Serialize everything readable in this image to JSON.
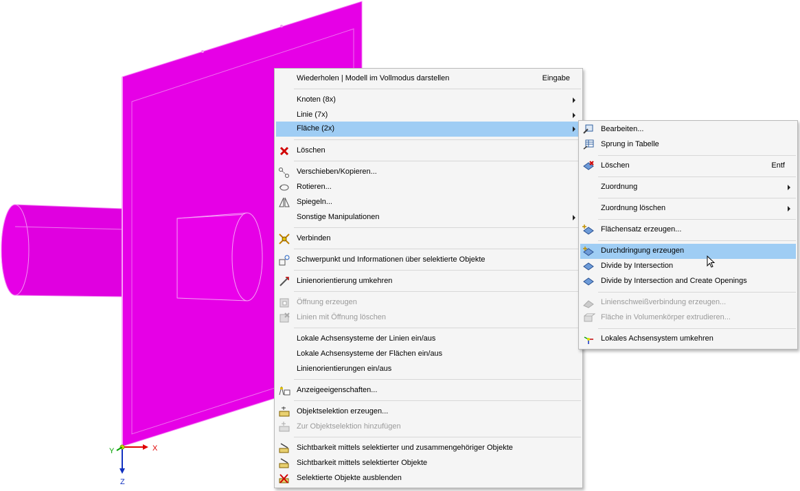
{
  "colors": {
    "model": "#e600e6",
    "menu_bg": "#f5f5f5",
    "highlight": "#9fcdf4",
    "disabled_text": "#9a9a9a"
  },
  "axes": {
    "x_label": "X",
    "y_label": "Y",
    "z_label": "Z"
  },
  "context_menu": {
    "items": [
      {
        "label": "Wiederholen | Modell im Vollmodus darstellen",
        "shortcut": "Eingabe"
      },
      {
        "label": "Knoten (8x)",
        "submenu": true
      },
      {
        "label": "Linie (7x)",
        "submenu": true
      },
      {
        "label": "Fläche (2x)",
        "submenu": true,
        "highlighted": true
      },
      {
        "label": "Löschen",
        "icon": "delete-x-icon"
      },
      {
        "label": "Verschieben/Kopieren...",
        "icon": "move-copy-icon"
      },
      {
        "label": "Rotieren...",
        "icon": "rotate-icon"
      },
      {
        "label": "Spiegeln...",
        "icon": "mirror-icon"
      },
      {
        "label": "Sonstige Manipulationen",
        "submenu": true
      },
      {
        "label": "Verbinden",
        "icon": "connect-icon"
      },
      {
        "label": "Schwerpunkt und Informationen über selektierte Objekte",
        "icon": "center-of-gravity-icon"
      },
      {
        "label": "Linienorientierung umkehren",
        "icon": "reverse-line-orientation-icon"
      },
      {
        "label": "Öffnung erzeugen",
        "icon": "create-opening-icon",
        "disabled": true
      },
      {
        "label": "Linien mit Öffnung löschen",
        "icon": "delete-opening-lines-icon",
        "disabled": true
      },
      {
        "label": "Lokale Achsensysteme der Linien ein/aus"
      },
      {
        "label": "Lokale Achsensysteme der Flächen ein/aus"
      },
      {
        "label": "Linienorientierungen ein/aus"
      },
      {
        "label": "Anzeigeeigenschaften...",
        "icon": "display-properties-icon"
      },
      {
        "label": "Objektselektion erzeugen...",
        "icon": "create-object-selection-icon"
      },
      {
        "label": "Zur Objektselektion hinzufügen",
        "icon": "add-to-selection-icon",
        "disabled": true
      },
      {
        "label": "Sichtbarkeit mittels selektierter und zusammengehöriger Objekte",
        "icon": "visibility-related-icon"
      },
      {
        "label": "Sichtbarkeit mittels selektierter Objekte",
        "icon": "visibility-selected-icon"
      },
      {
        "label": "Selektierte Objekte ausblenden",
        "icon": "hide-selected-icon"
      }
    ]
  },
  "submenu": {
    "items": [
      {
        "label": "Bearbeiten...",
        "icon": "edit-surface-icon"
      },
      {
        "label": "Sprung in Tabelle",
        "icon": "jump-to-table-icon"
      },
      {
        "label": "Löschen",
        "shortcut": "Entf",
        "icon": "delete-surface-icon"
      },
      {
        "label": "Zuordnung",
        "submenu": true
      },
      {
        "label": "Zuordnung löschen",
        "submenu": true
      },
      {
        "label": "Flächensatz erzeugen...",
        "icon": "create-surface-set-icon"
      },
      {
        "label": "Durchdringung erzeugen",
        "icon": "create-intersection-icon",
        "highlighted": true
      },
      {
        "label": "Divide by Intersection",
        "icon": "divide-intersection-icon"
      },
      {
        "label": "Divide by Intersection and Create Openings",
        "icon": "divide-openings-icon"
      },
      {
        "label": "Linienschweißverbindung erzeugen...",
        "icon": "weld-icon",
        "disabled": true
      },
      {
        "label": "Fläche in Volumenkörper extrudieren...",
        "icon": "extrude-icon",
        "disabled": true
      },
      {
        "label": "Lokales Achsensystem umkehren",
        "icon": "reverse-axis-icon"
      }
    ]
  }
}
